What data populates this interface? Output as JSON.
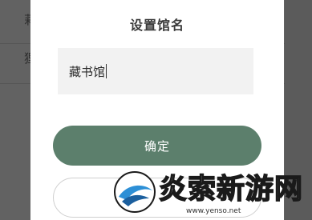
{
  "dialog": {
    "title": "设置馆名",
    "input_value": "藏书馆",
    "confirm_label": "确定"
  },
  "background": {
    "glyph_1": "莉",
    "glyph_2": "狸"
  },
  "watermark": {
    "text": "炎索新游网",
    "url": "www.yenso.net"
  },
  "colors": {
    "confirm_button": "#5c7f6c",
    "overlay": "#626262"
  }
}
